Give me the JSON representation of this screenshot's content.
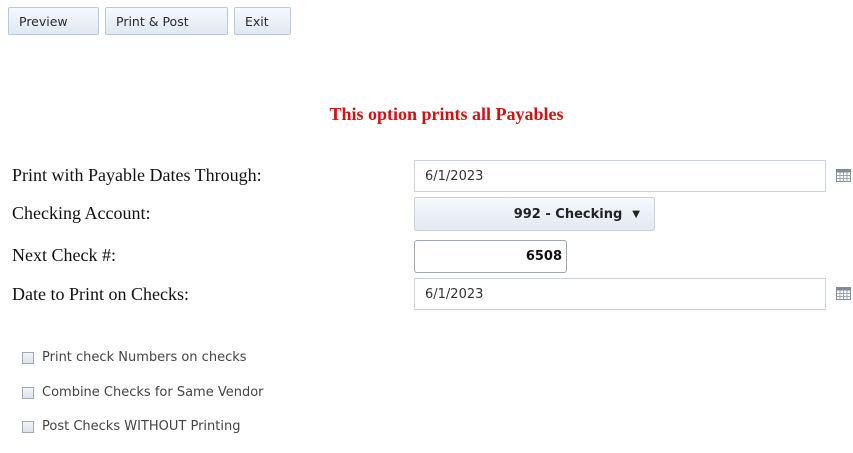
{
  "toolbar": {
    "preview_label": "Preview",
    "print_post_label": "Print & Post",
    "exit_label": "Exit"
  },
  "notice": "This option prints all Payables",
  "form": {
    "payable_dates_label": "Print with Payable Dates Through:",
    "payable_dates_value": "6/1/2023",
    "checking_account_label": "Checking Account:",
    "checking_account_value": "992 - Checking",
    "next_check_label": "Next Check #:",
    "next_check_value": "6508",
    "print_date_label": "Date to Print on Checks:",
    "print_date_value": "6/1/2023"
  },
  "options": [
    {
      "label": "Print check Numbers on checks",
      "checked": false
    },
    {
      "label": "Combine Checks for Same Vendor",
      "checked": false
    },
    {
      "label": "Post Checks WITHOUT Printing",
      "checked": false
    }
  ],
  "icons": {
    "calendar": "calendar-icon",
    "dropdown": "chevron-down-icon"
  },
  "colors": {
    "notice": "#d11212",
    "button_gradient_top": "#f6f9fd",
    "button_gradient_bottom": "#dfe8f3",
    "border": "#c8d3e1"
  }
}
